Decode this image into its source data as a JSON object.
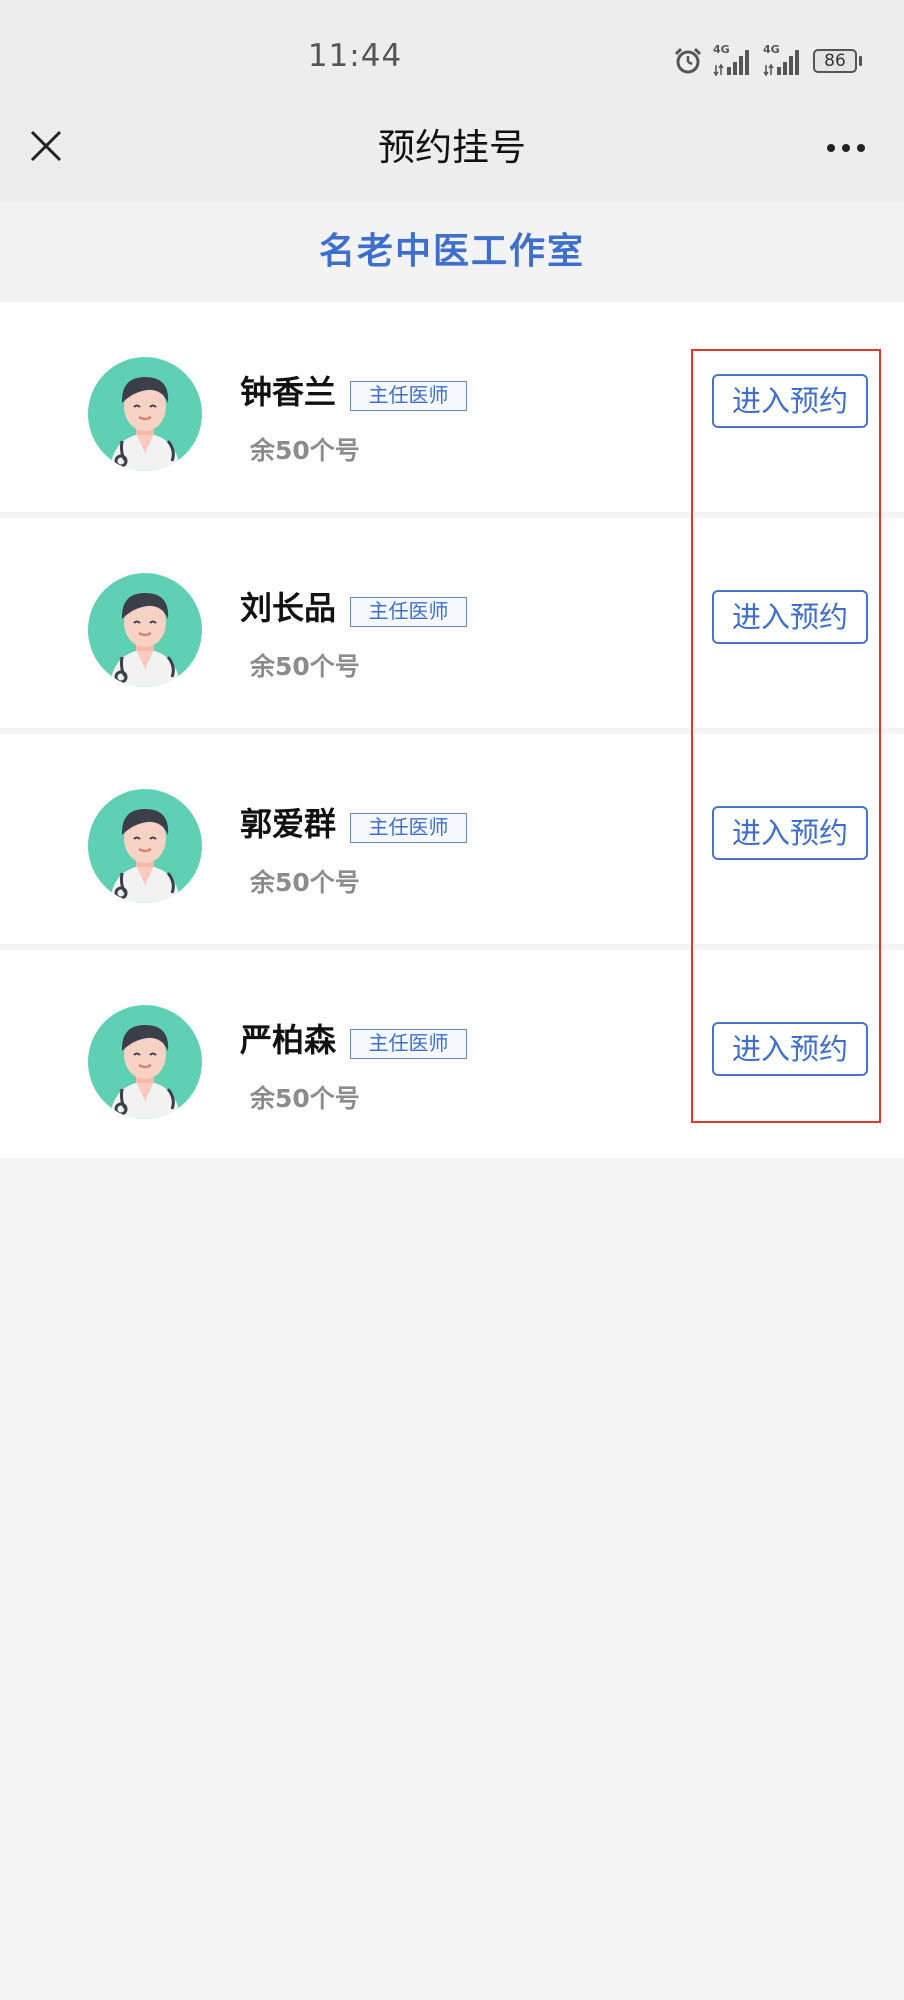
{
  "status": {
    "time": "11:44",
    "signal_1_label": "4G",
    "signal_2_label": "4G",
    "battery": "86",
    "icons": [
      "alarm-icon",
      "signal-icon",
      "signal-icon",
      "battery-icon"
    ]
  },
  "nav": {
    "title": "预约挂号",
    "close_icon": "close-icon",
    "more_icon": "more-icon"
  },
  "studio": {
    "title": "名老中医工作室"
  },
  "doctors": [
    {
      "name": "钟香兰",
      "title": "主任医师",
      "remaining": "余50个号",
      "button": "进入预约"
    },
    {
      "name": "刘长品",
      "title": "主任医师",
      "remaining": "余50个号",
      "button": "进入预约"
    },
    {
      "name": "郭爱群",
      "title": "主任医师",
      "remaining": "余50个号",
      "button": "进入预约"
    },
    {
      "name": "严柏森",
      "title": "主任医师",
      "remaining": "余50个号",
      "button": "进入预约"
    }
  ],
  "colors": {
    "accent": "#3e6fcd",
    "highlight": "#e8352b",
    "avatar_bg": "#5fd0b3"
  }
}
